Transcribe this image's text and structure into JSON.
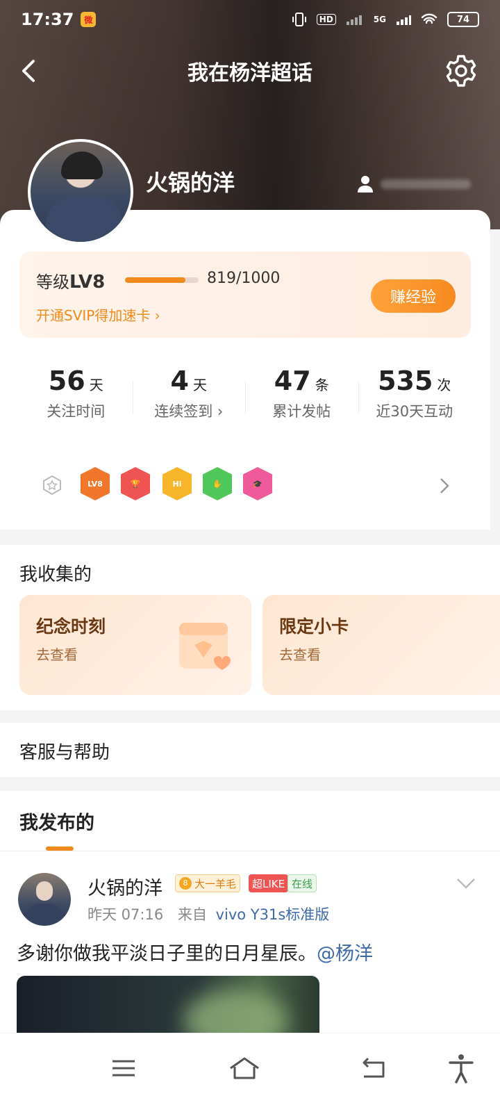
{
  "status_bar": {
    "time": "17:37",
    "hd": "HD",
    "network": "5G",
    "battery": "74"
  },
  "nav": {
    "title": "我在杨洋超话"
  },
  "profile": {
    "username": "火锅的洋"
  },
  "level": {
    "label": "等级",
    "level": "LV8",
    "progress_text": "819/1000",
    "progress_fraction": 0.819,
    "svip_link": "开通SVIP得加速卡 ›",
    "earn_button": "赚经验"
  },
  "stats": [
    {
      "value": "56",
      "unit": "天",
      "label": "关注时间"
    },
    {
      "value": "4",
      "unit": "天",
      "label": "连续签到 ›"
    },
    {
      "value": "47",
      "unit": "条",
      "label": "累计发帖"
    },
    {
      "value": "535",
      "unit": "次",
      "label": "近30天互动"
    }
  ],
  "badges": [
    {
      "name": "lv8-medal-icon",
      "text": "LV8",
      "color": "#f0762a"
    },
    {
      "name": "trophy-medal-icon",
      "text": "",
      "color": "#ee5451"
    },
    {
      "name": "hi-medal-icon",
      "text": "Hi",
      "color": "#f7b52c"
    },
    {
      "name": "hand-medal-icon",
      "text": "",
      "color": "#4fc75a"
    },
    {
      "name": "cap-medal-icon",
      "text": "",
      "color": "#ee5a9a"
    }
  ],
  "collections": {
    "title": "我收集的",
    "items": [
      {
        "title": "纪念时刻",
        "sub": "去查看"
      },
      {
        "title": "限定小卡",
        "sub": "去查看"
      }
    ]
  },
  "help": {
    "label": "客服与帮助"
  },
  "posts": {
    "tab": "我发布的",
    "item": {
      "author": "火锅的洋",
      "fan_tag_level": "8",
      "fan_tag": "大一羊毛",
      "tag_like": "超LIKE",
      "tag_online": "在线",
      "time": "昨天 07:16",
      "source_prefix": "来自",
      "source": "vivo Y31s标准版",
      "text": "多谢你做我平淡日子里的日月星辰。",
      "mention": "@杨洋"
    }
  },
  "colors": {
    "accent": "#f08a1c",
    "mention": "#3d6aa8"
  }
}
